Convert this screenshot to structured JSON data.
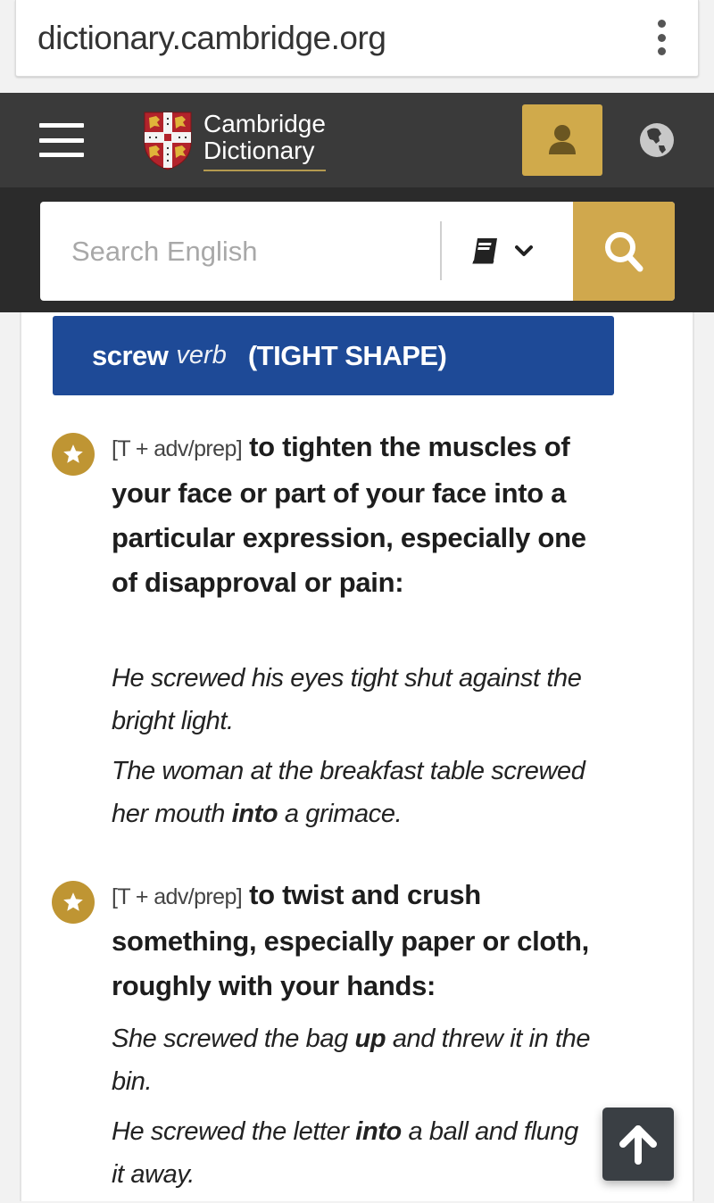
{
  "browser": {
    "url": "dictionary.cambridge.org",
    "menu_icon": "kebab-menu-icon"
  },
  "header": {
    "menu_icon": "hamburger-icon",
    "logo_line1": "Cambridge",
    "logo_line2": "Dictionary",
    "user_icon": "user-icon",
    "language_icon": "globe-icon",
    "colors": {
      "bar": "#3a3a3a",
      "accent": "#d0aa4b"
    }
  },
  "search": {
    "placeholder": "Search English",
    "value": "",
    "dictionary_icon": "book-icon",
    "dropdown_icon": "chevron-down-icon",
    "submit_icon": "search-icon",
    "submit_color": "#d0a84d"
  },
  "entry": {
    "headword": "screw",
    "part_of_speech": "verb",
    "guideword": "(TIGHT SHAPE)",
    "header_color": "#1e4a97",
    "senses": [
      {
        "icon": "star-icon",
        "grammar": "[T + adv/prep]",
        "definition": "to tighten the muscles of your face or part of your face into a particular expression, especially one of disapproval or pain:",
        "examples": [
          {
            "before": "He screwed his eyes tight shut against the bright light.",
            "bold": "",
            "after": ""
          },
          {
            "before": "The woman at the breakfast table screwed her mouth ",
            "bold": "into",
            "after": " a grimace."
          }
        ]
      },
      {
        "icon": "star-icon",
        "grammar": "[T + adv/prep]",
        "definition": "to twist and crush something, especially paper or cloth, roughly with your hands:",
        "examples": [
          {
            "before": "She screwed the bag ",
            "bold": "up",
            "after": " and threw it in the bin."
          },
          {
            "before": "He screwed the letter ",
            "bold": "into",
            "after": " a ball and flung it away."
          }
        ]
      }
    ]
  },
  "back_to_top": {
    "icon": "arrow-up-icon"
  }
}
